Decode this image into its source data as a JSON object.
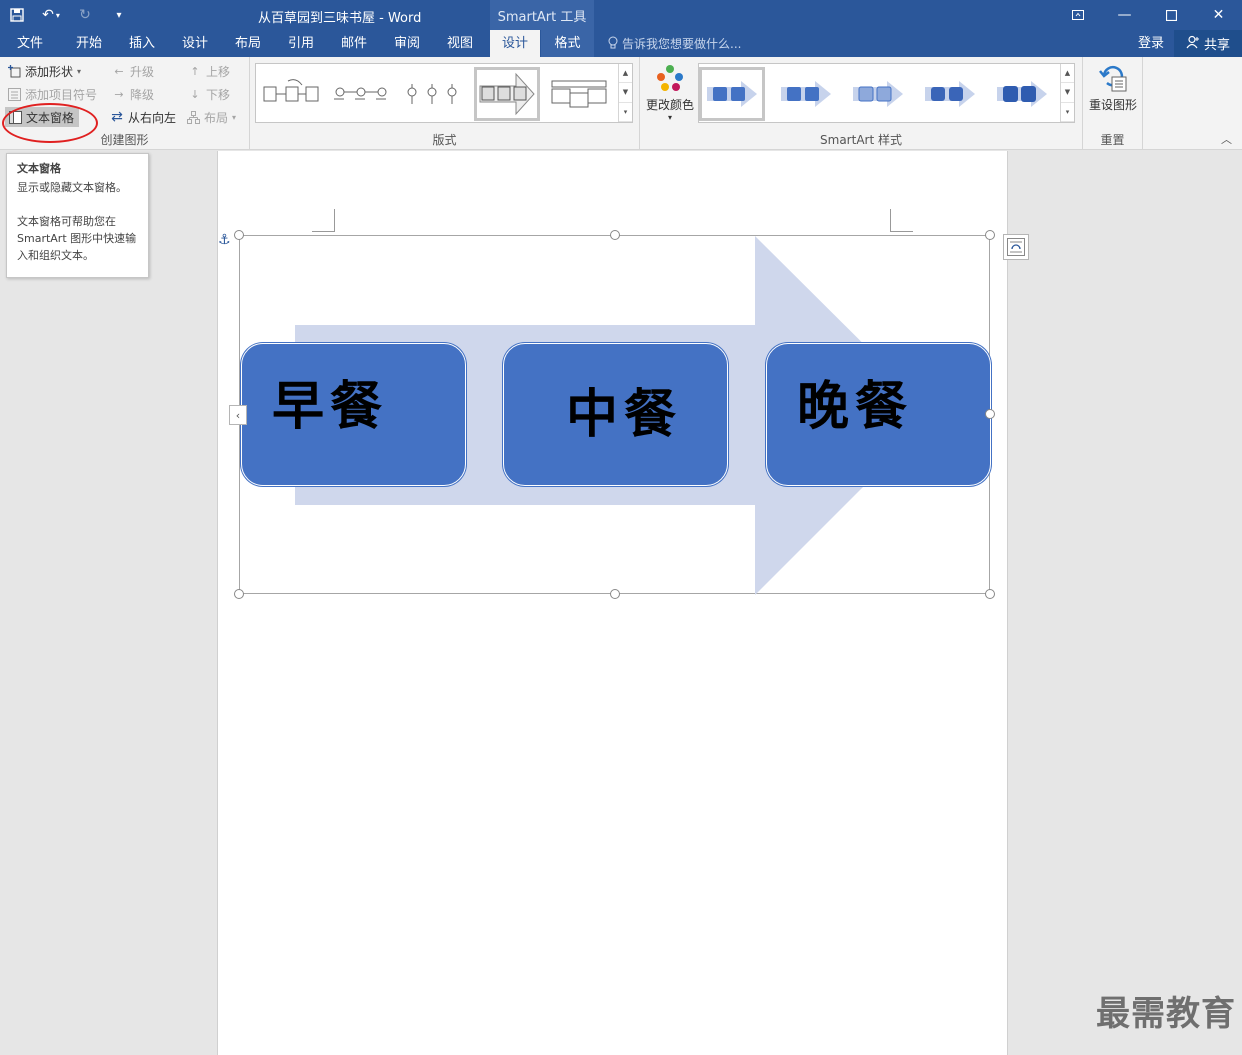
{
  "titlebar": {
    "doc_title": "从百草园到三味书屋 - Word",
    "context_header": "SmartArt 工具"
  },
  "tabs": [
    {
      "label": "文件"
    },
    {
      "label": "开始"
    },
    {
      "label": "插入"
    },
    {
      "label": "设计"
    },
    {
      "label": "布局"
    },
    {
      "label": "引用"
    },
    {
      "label": "邮件"
    },
    {
      "label": "审阅"
    },
    {
      "label": "视图"
    },
    {
      "label": "设计"
    },
    {
      "label": "格式"
    }
  ],
  "tell_me": "告诉我您想要做什么...",
  "signin": "登录",
  "share": "共享",
  "ribbon": {
    "create": {
      "add_shape": "添加形状",
      "add_bullet": "添加项目符号",
      "text_pane": "文本窗格",
      "promote": "升级",
      "demote": "降级",
      "rtl": "从右向左",
      "move_up": "上移",
      "move_down": "下移",
      "layout": "布局",
      "label": "创建图形"
    },
    "layouts_label": "版式",
    "change_colors": "更改颜色",
    "styles_label": "SmartArt 样式",
    "reset_graphic": "重设图形",
    "reset_label": "重置"
  },
  "tooltip": {
    "title": "文本窗格",
    "line1": "显示或隐藏文本窗格。",
    "line2": "文本窗格可帮助您在 SmartArt 图形中快速输入和组织文本。"
  },
  "smartart": {
    "colors": {
      "box": "#4472c4",
      "arrow": "#cfd7ec"
    },
    "boxes": [
      {
        "label": "早餐"
      },
      {
        "label": "中餐"
      },
      {
        "label": "晚餐"
      }
    ]
  },
  "watermark": "最需教育"
}
